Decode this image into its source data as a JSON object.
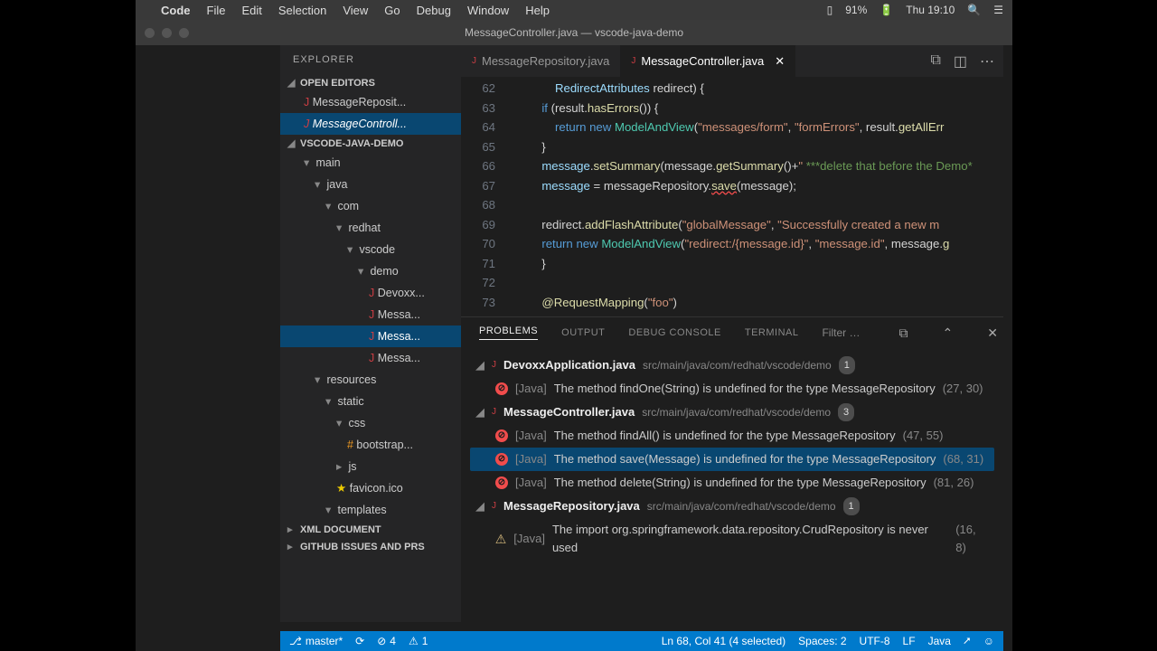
{
  "menubar": {
    "app": "Code",
    "items": [
      "File",
      "Edit",
      "Selection",
      "View",
      "Go",
      "Debug",
      "Window",
      "Help"
    ],
    "battery": "91%",
    "clock": "Thu 19:10"
  },
  "window_title": "MessageController.java — vscode-java-demo",
  "explorer_title": "EXPLORER",
  "sections": {
    "open_editors": "OPEN EDITORS",
    "project": "VSCODE-JAVA-DEMO",
    "xml": "XML DOCUMENT",
    "gh": "GITHUB ISSUES AND PRS"
  },
  "open_editors": [
    {
      "name": "MessageReposit...",
      "active": false
    },
    {
      "name": "MessageControll...",
      "active": true
    }
  ],
  "tree": [
    {
      "label": "main",
      "indent": 1,
      "tw": "▾"
    },
    {
      "label": "java",
      "indent": 2,
      "tw": "▾"
    },
    {
      "label": "com",
      "indent": 3,
      "tw": "▾"
    },
    {
      "label": "redhat",
      "indent": 4,
      "tw": "▾"
    },
    {
      "label": "vscode",
      "indent": 5,
      "tw": "▾"
    },
    {
      "label": "demo",
      "indent": 6,
      "tw": "▾"
    },
    {
      "label": "Devoxx...",
      "indent": 7,
      "icon": "J"
    },
    {
      "label": "Messa...",
      "indent": 7,
      "icon": "J"
    },
    {
      "label": "Messa...",
      "indent": 7,
      "icon": "J",
      "active": true
    },
    {
      "label": "Messa...",
      "indent": 7,
      "icon": "J"
    },
    {
      "label": "resources",
      "indent": 2,
      "tw": "▾"
    },
    {
      "label": "static",
      "indent": 3,
      "tw": "▾"
    },
    {
      "label": "css",
      "indent": 4,
      "tw": "▾"
    },
    {
      "label": "bootstrap...",
      "indent": 5,
      "icon": "#",
      "cls": "fico-css"
    },
    {
      "label": "js",
      "indent": 4,
      "tw": "▸"
    },
    {
      "label": "favicon.ico",
      "indent": 4,
      "icon": "★",
      "cls": "fico-star"
    },
    {
      "label": "templates",
      "indent": 3,
      "tw": "▾"
    }
  ],
  "tabs": [
    {
      "label": "MessageRepository.java",
      "active": false
    },
    {
      "label": "MessageController.java",
      "active": true,
      "close": true
    }
  ],
  "gutter": [
    "62",
    "63",
    "64",
    "65",
    "66",
    "67",
    "68",
    "69",
    "70",
    "71",
    "72",
    "73"
  ],
  "code_lines": [
    "    <span class='v'>RedirectAttributes</span> redirect) {",
    "<span class='k'>if</span> (result.<span class='m'>hasErrors</span>()) {",
    "    <span class='k'>return</span> <span class='k'>new</span> <span class='t'>ModelAndView</span>(<span class='s'>\"messages/form\"</span>, <span class='s'>\"formErrors\"</span>, result.<span class='m'>getAllErr</span>",
    "}",
    "<span class='v'>message</span>.<span class='m'>setSummary</span>(message.<span class='m'>getSummary</span>()+<span class='s'>\" </span><span class='c'>***delete that before the Demo*</span>",
    "<span class='v'>message</span> = messageRepository.<span class='m werr'>save</span>(message);",
    "",
    "redirect.<span class='m'>addFlashAttribute</span>(<span class='s'>\"globalMessage\"</span>, <span class='s'>\"Successfully created a new m</span>",
    "<span class='k'>return</span> <span class='k'>new</span> <span class='t'>ModelAndView</span>(<span class='s'>\"redirect:/{message.id}\"</span>, <span class='s'>\"message.id\"</span>, message.<span class='m'>g</span>",
    "}",
    ""
  ],
  "code_tail": "    <span class='ann'>@RequestMapping</span>(<span class='s'>\"foo\"</span>)",
  "panel": {
    "tabs": [
      "PROBLEMS",
      "OUTPUT",
      "DEBUG CONSOLE",
      "TERMINAL"
    ],
    "active": 0,
    "filter": "Filter by type or t..."
  },
  "problems": [
    {
      "kind": "file",
      "name": "DevoxxApplication.java",
      "path": "src/main/java/com/redhat/vscode/demo",
      "count": "1"
    },
    {
      "kind": "err",
      "tag": "[Java]",
      "msg": "The method findOne(String) is undefined for the type MessageRepository",
      "loc": "(27, 30)"
    },
    {
      "kind": "file",
      "name": "MessageController.java",
      "path": "src/main/java/com/redhat/vscode/demo",
      "count": "3"
    },
    {
      "kind": "err",
      "tag": "[Java]",
      "msg": "The method findAll() is undefined for the type MessageRepository",
      "loc": "(47, 55)"
    },
    {
      "kind": "err",
      "tag": "[Java]",
      "msg": "The method save(Message) is undefined for the type MessageRepository",
      "loc": "(68, 31)",
      "sel": true
    },
    {
      "kind": "err",
      "tag": "[Java]",
      "msg": "The method delete(String) is undefined for the type MessageRepository",
      "loc": "(81, 26)"
    },
    {
      "kind": "file",
      "name": "MessageRepository.java",
      "path": "src/main/java/com/redhat/vscode/demo",
      "count": "1"
    },
    {
      "kind": "warn",
      "tag": "[Java]",
      "msg": "The import org.springframework.data.repository.CrudRepository is never used",
      "loc": "(16, 8)"
    }
  ],
  "status": {
    "branch": "master*",
    "errors": "4",
    "warnings": "1",
    "cursor": "Ln 68, Col 41 (4 selected)",
    "spaces": "Spaces: 2",
    "encoding": "UTF-8",
    "eol": "LF",
    "lang": "Java"
  }
}
